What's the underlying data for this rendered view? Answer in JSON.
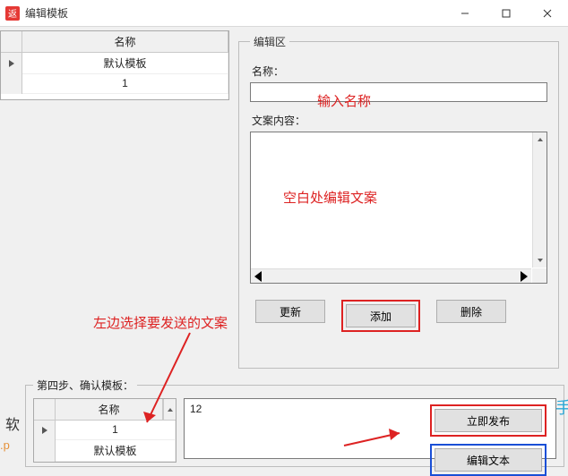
{
  "window": {
    "icon_text": "返",
    "title": "编辑模板"
  },
  "left_grid": {
    "header": "名称",
    "rows": [
      "默认模板",
      "1"
    ]
  },
  "edit_group": {
    "legend": "编辑区",
    "name_label": "名称：",
    "content_label": "文案内容：",
    "btn_update": "更新",
    "btn_add": "添加",
    "btn_delete": "删除"
  },
  "annotations": {
    "name_hint": "输入名称",
    "content_hint": "空白处编辑文案",
    "select_hint": "左边选择要发送的文案"
  },
  "step_group": {
    "legend": "第四步、确认模板：",
    "grid_header": "名称",
    "grid_rows": [
      "1",
      "默认模板"
    ],
    "content_text": "12",
    "btn_publish": "立即发布",
    "btn_edit_text": "编辑文本"
  },
  "cropped": {
    "left1": "软",
    "left2": ".p",
    "right": "手"
  }
}
